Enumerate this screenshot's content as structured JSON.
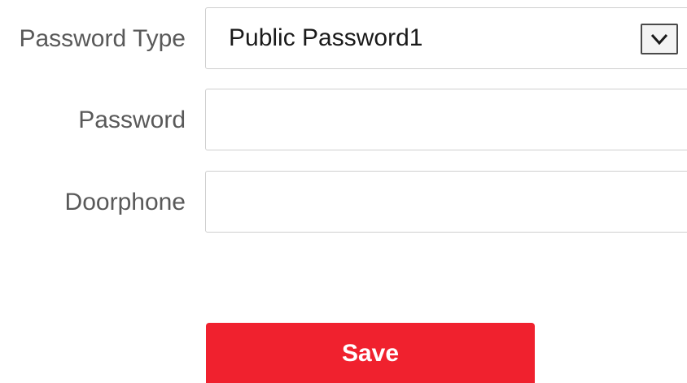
{
  "form": {
    "password_type": {
      "label": "Password Type",
      "selected": "Public Password1"
    },
    "password": {
      "label": "Password",
      "value": "",
      "placeholder": ""
    },
    "doorphone": {
      "label": "Doorphone",
      "value": "",
      "placeholder": ""
    },
    "save_label": "Save"
  },
  "icons": {
    "dropdown": "chevron-down-icon"
  },
  "colors": {
    "save_button": "#f0212e",
    "label_text": "#595959",
    "field_border": "#cfcfcf"
  }
}
